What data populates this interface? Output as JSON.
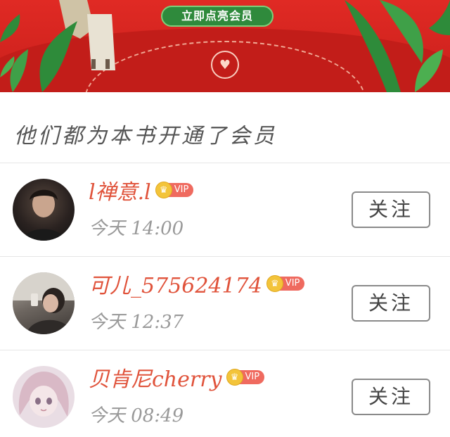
{
  "banner": {
    "cta_label": "立即点亮会员",
    "colors": {
      "background": "#d3231f",
      "cta": "#2f8a3c",
      "leaf": "#2e8b3a"
    }
  },
  "section": {
    "title": "他们都为本书开通了会员"
  },
  "members": [
    {
      "name": "l禅意.l",
      "vip_label": "VIP",
      "time": "今天 14:00",
      "follow_label": "关注"
    },
    {
      "name": "可儿_575624174",
      "vip_label": "VIP",
      "time": "今天 12:37",
      "follow_label": "关注"
    },
    {
      "name": "贝肯尼cherry",
      "vip_label": "VIP",
      "time": "今天 08:49",
      "follow_label": "关注"
    }
  ]
}
